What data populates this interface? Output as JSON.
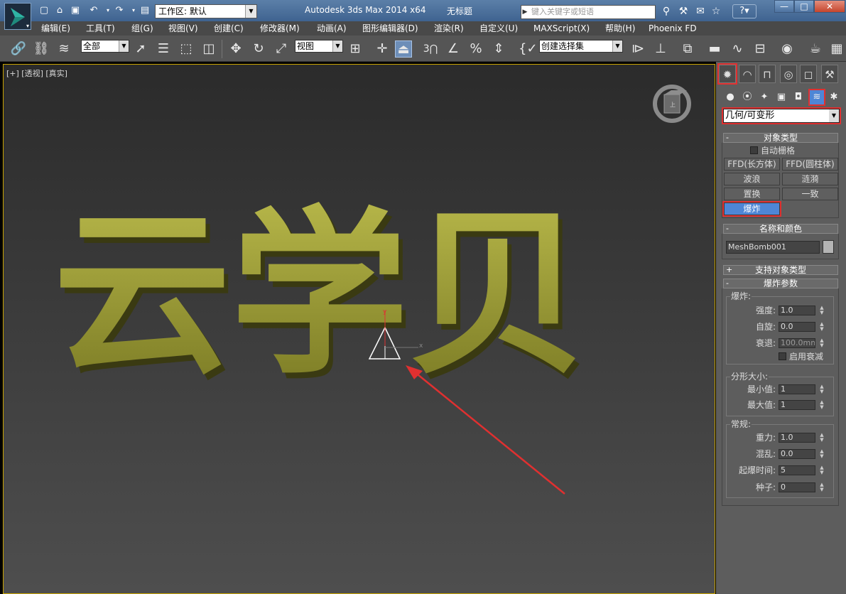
{
  "titlebar": {
    "title": "Autodesk 3ds Max  2014 x64",
    "file": "无标题",
    "workspace": "工作区: 默认",
    "search_placeholder": "键入关键字或短语"
  },
  "menu": [
    "编辑(E)",
    "工具(T)",
    "组(G)",
    "视图(V)",
    "创建(C)",
    "修改器(M)",
    "动画(A)",
    "图形编辑器(D)",
    "渲染(R)",
    "自定义(U)",
    "MAXScript(X)",
    "帮助(H)",
    "Phoenix FD"
  ],
  "toolbar": {
    "filter": "全部",
    "coord_system": "视图",
    "selection_set": "创建选择集",
    "snap_label": "3"
  },
  "viewport": {
    "label": "[+] [透视] [真实]",
    "scene_text": "云学贝",
    "axis_x": "x",
    "axis_y": "y",
    "accent": "#e03030"
  },
  "panel": {
    "category": "几何/可变形",
    "object_type": {
      "title": "对象类型",
      "autogrid": "自动栅格",
      "buttons": [
        "FFD(长方体)",
        "FFD(圆柱体)",
        "波浪",
        "涟漪",
        "置换",
        "一致",
        "爆炸"
      ]
    },
    "name_color": {
      "title": "名称和颜色",
      "name": "MeshBomb001",
      "swatch": "#b4b4b4"
    },
    "supported_types": "支持对象类型",
    "bomb_params": {
      "title": "爆炸参数",
      "explosion": {
        "title": "爆炸:",
        "strength_label": "强度:",
        "strength": "1.0",
        "spin_label": "自旋:",
        "spin": "0.0",
        "falloff_label": "衰退:",
        "falloff": "100.0mm",
        "enable_falloff": "启用衰减"
      },
      "fragment": {
        "title": "分形大小:",
        "min_label": "最小值:",
        "min": "1",
        "max_label": "最大值:",
        "max": "1"
      },
      "general": {
        "title": "常规:",
        "gravity_label": "重力:",
        "gravity": "1.0",
        "chaos_label": "混乱:",
        "chaos": "0.0",
        "detonation_label": "起爆时间:",
        "detonation": "5",
        "seed_label": "种子:",
        "seed": "0"
      }
    }
  }
}
